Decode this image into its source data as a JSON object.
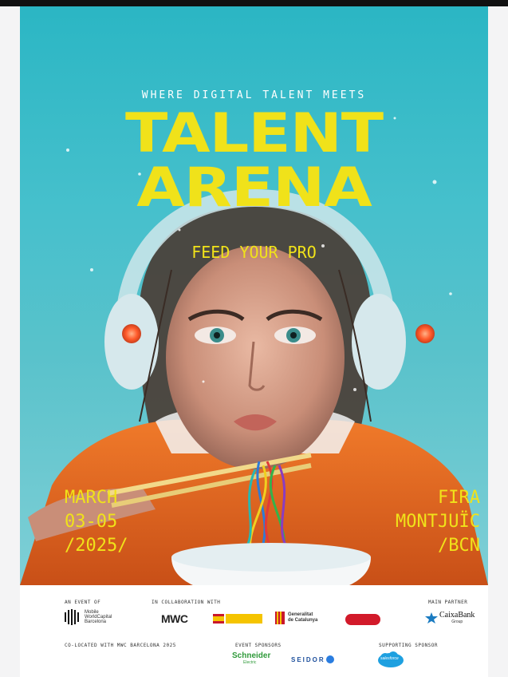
{
  "poster": {
    "tagline": "WHERE DIGITAL TALENT MEETS",
    "title_line1": "TALENT",
    "title_line2": "ARENA",
    "subtitle": "FEED YOUR PRO",
    "date_lines": [
      "MARCH",
      "03-05",
      "/2025/"
    ],
    "venue_lines": [
      "FIRA",
      "MONTJUÏC",
      "/BCN"
    ]
  },
  "footer": {
    "an_event_of": "AN EVENT OF",
    "collaboration": "IN COLLABORATION WITH",
    "main_partner": "MAIN PARTNER",
    "colocated": "CO-LOCATED WITH MWC BARCELONA 2025",
    "event_sponsors": "EVENT SPONSORS",
    "supporting_sponsor": "SUPPORTING SPONSOR",
    "logos": {
      "mwcapital": "Mobile\nWorldCapital\nBarcelona",
      "mwc": "MWC",
      "generalitat": "Generalitat\nde Catalunya",
      "caixabank": "CaixaBank",
      "caixabank_sub": "Group",
      "schneider": "Schneider",
      "schneider_sub": "Electric",
      "seidor": "SEIDOR",
      "salesforce": "salesforce"
    }
  },
  "colors": {
    "accent_yellow": "#f0e21a",
    "background_teal": "#46c0cc",
    "jacket_orange": "#e0641f"
  }
}
